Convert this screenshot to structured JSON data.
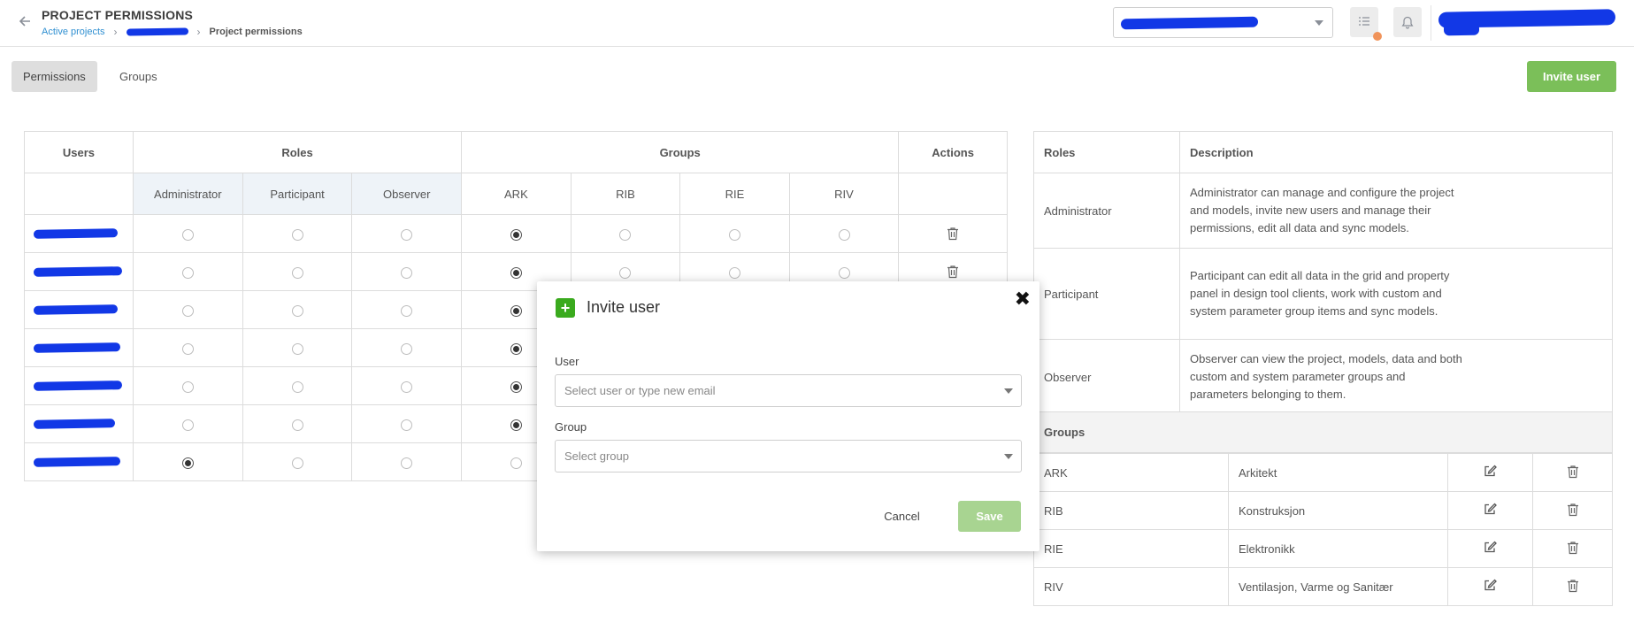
{
  "header": {
    "title": "PROJECT PERMISSIONS",
    "breadcrumb": {
      "root": "Active projects",
      "current": "Project permissions"
    }
  },
  "tabs": [
    {
      "label": "Permissions",
      "active": true
    },
    {
      "label": "Groups",
      "active": false
    }
  ],
  "toolbar": {
    "invite_label": "Invite user"
  },
  "permissions_table": {
    "headers": {
      "users": "Users",
      "roles": "Roles",
      "groups": "Groups",
      "actions": "Actions"
    },
    "roles": [
      "Administrator",
      "Participant",
      "Observer"
    ],
    "groups": [
      "ARK",
      "RIB",
      "RIE",
      "RIV"
    ],
    "rows": [
      {
        "role": null,
        "group": "ARK"
      },
      {
        "role": null,
        "group": "ARK"
      },
      {
        "role": null,
        "group": "ARK"
      },
      {
        "role": null,
        "group": "ARK"
      },
      {
        "role": null,
        "group": "ARK"
      },
      {
        "role": null,
        "group": "ARK"
      },
      {
        "role": "Administrator",
        "group": null
      }
    ]
  },
  "roles_panel": {
    "headers": {
      "roles": "Roles",
      "description": "Description"
    },
    "items": [
      {
        "name": "Administrator",
        "description": "Administrator can manage and configure the project and models, invite new users and manage their permissions, edit all data and sync models."
      },
      {
        "name": "Participant",
        "description": "Participant can edit all data in the grid and property panel in design tool clients, work with custom and system parameter group items and sync models."
      },
      {
        "name": "Observer",
        "description": "Observer can view the project, models, data and both custom and system parameter groups and parameters belonging to them."
      }
    ]
  },
  "groups_panel": {
    "title": "Groups",
    "items": [
      {
        "code": "ARK",
        "name": "Arkitekt"
      },
      {
        "code": "RIB",
        "name": "Konstruksjon"
      },
      {
        "code": "RIE",
        "name": "Elektronikk"
      },
      {
        "code": "RIV",
        "name": "Ventilasjon, Varme og Sanitær"
      }
    ]
  },
  "modal": {
    "title": "Invite user",
    "user_label": "User",
    "user_placeholder": "Select user or type new email",
    "group_label": "Group",
    "group_placeholder": "Select group",
    "cancel_label": "Cancel",
    "save_label": "Save"
  },
  "colors": {
    "accent_green": "#7bbf59",
    "save_disabled_green": "#a8d491",
    "link_blue": "#2f8fd1",
    "redaction_blue": "#1238e6",
    "notification_orange": "#f0935a"
  }
}
